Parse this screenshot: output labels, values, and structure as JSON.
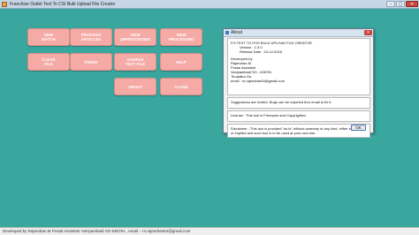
{
  "window": {
    "title": "Franchise Outlet Text To CSI Bulk Upload File Creator",
    "controls": [
      "–",
      "▢",
      "✕"
    ]
  },
  "buttons": [
    {
      "label": "NEW\nBATCH"
    },
    {
      "label": "PROCESS\nARTICLES"
    },
    {
      "label": "VIEW\nUNPROCESSED"
    },
    {
      "label": "VIEW\nPROCESSED"
    },
    {
      "label": "CLEAR\nFILE"
    },
    {
      "label": "FINISH"
    },
    {
      "label": "SAMPLE\nTEXT FILE"
    },
    {
      "label": "HELP"
    },
    {
      "label": "ABOUT"
    },
    {
      "label": "CLOSE"
    }
  ],
  "about": {
    "title": "About",
    "close": "✕",
    "lines": {
      "app_name": "FO TEXT TO POS BULK UPLOAD FILE CREATOR",
      "version": "Version : 1.0.0",
      "release": "Release Date : 24-12-2018",
      "dev_heading": "Developed by",
      "dev_name": "Rajendran.M",
      "dev_role": "Postal Assistant",
      "dev_office": "Vaniyambadi SO - 635751",
      "dev_division": "Tirupattur Dn.",
      "dev_email": "email : m.rajendran64@gmail.com"
    },
    "suggestions": "Suggestions are invited. Bugs can be reported thru email to fix it.",
    "license": "License : This tool is Freeware and Copyrighted.",
    "disclaimer_1": "Disclaimer : This tool is provided \"as is\" without warranty of any kind, either expressed",
    "disclaimer_2": "or implied and such tool is to be used at your own risk.",
    "ok_label": "OK"
  },
  "statusbar": {
    "text": "Developed by Rajendran.M Postal Assistant Vaniyambadi SO 635751 , email :- m.rajendran64@gmail.com"
  }
}
